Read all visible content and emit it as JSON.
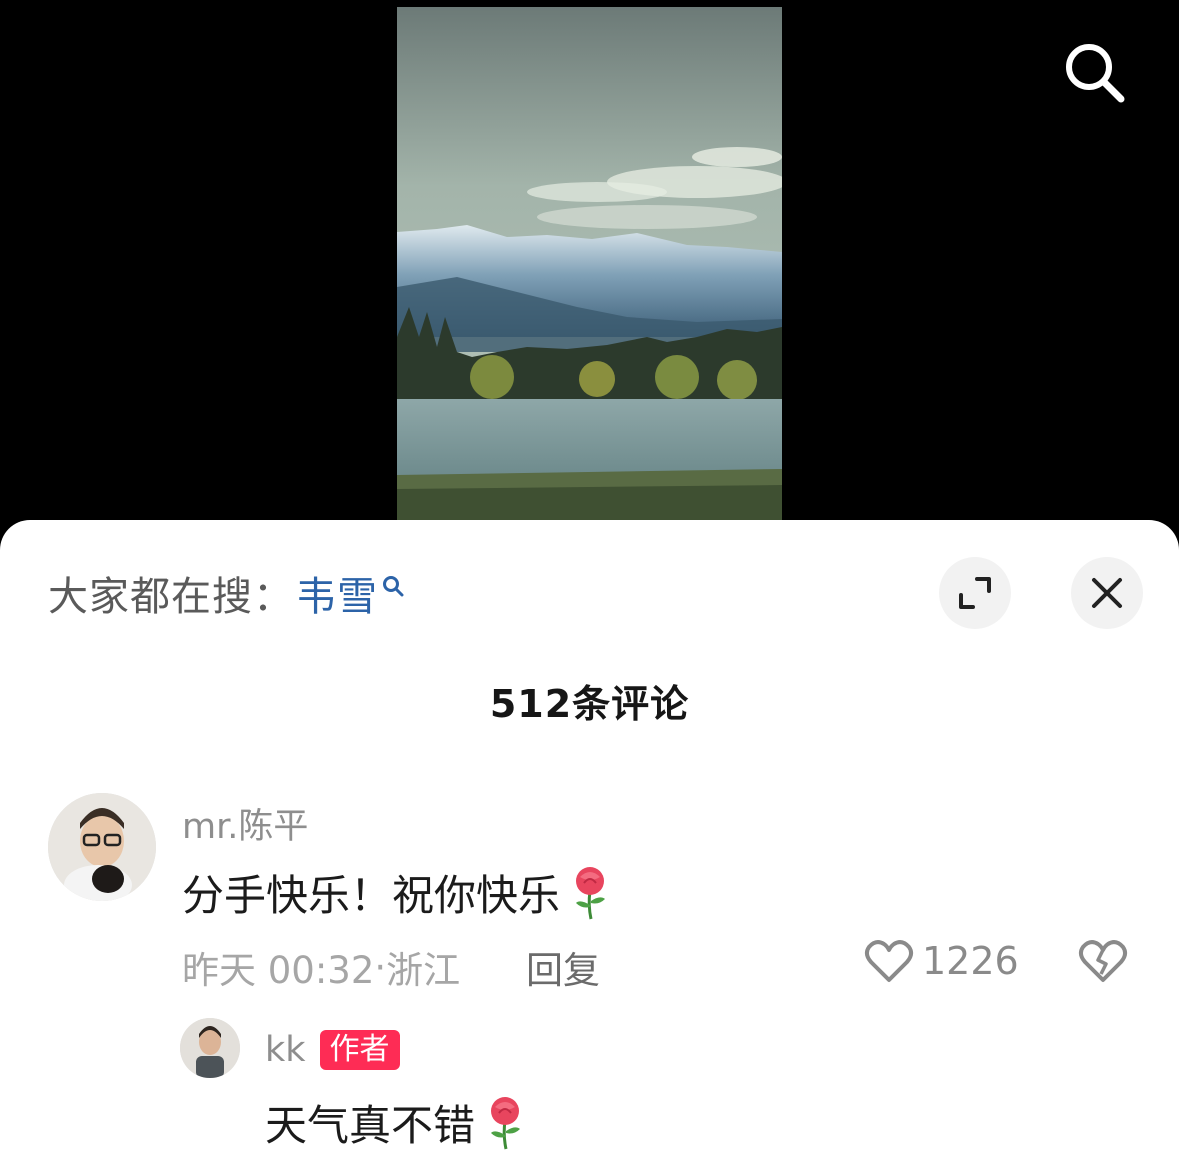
{
  "top_bar": {
    "search_icon": "search-icon"
  },
  "video": {
    "description_icon": "landscape-video"
  },
  "comment_sheet": {
    "hot_search": {
      "prefix": "大家都在搜：",
      "term": "韦雪"
    },
    "expand_icon": "expand-icon",
    "close_icon": "close-icon",
    "comment_count": "512条评论",
    "comments": [
      {
        "username": "mr.陈平",
        "text": "分手快乐！祝你快乐",
        "emoji_icon": "rose-icon",
        "time": "昨天 00:32",
        "separator": "·",
        "location": "浙江",
        "reply_label": "回复",
        "likes": "1226"
      },
      {
        "username": "kk",
        "badge": "作者",
        "text": "天气真不错",
        "emoji_icon": "rose-icon"
      }
    ]
  },
  "colors": {
    "accent": "#2c63a8",
    "badge": "#fe2c55",
    "background": "#000000"
  }
}
